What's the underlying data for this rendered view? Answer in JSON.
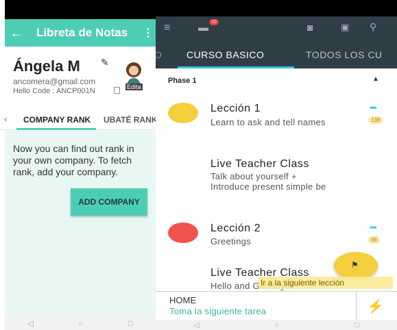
{
  "left_app": {
    "title": "Libreta de Notas",
    "back_icon": "back-arrow-icon",
    "more_icon": "more-vert-icon",
    "profile": {
      "name": "Ángela M",
      "email": "ancomera@gmail.com",
      "hello_code": "Hello Code : ANCP001N",
      "avatar_label": "Edita"
    },
    "tabs": [
      "COMPANY RANK",
      "UBATÉ RANK"
    ],
    "active_tab": "COMPANY RANK",
    "message": "Now you can find out rank in your own company. To fetch rank, add your company.",
    "add_button": "ADD COMPANY",
    "accent": "#4ecdb5"
  },
  "right_app": {
    "chat_badge": "10",
    "tabs": [
      "O",
      "CURSO BASICO",
      "TODOS LOS CU"
    ],
    "active_tab": "CURSO BASICO",
    "phase": "Phase 1",
    "lessons": [
      {
        "title": "Lección 1",
        "subtitle": "Learn to ask and tell names",
        "count": "138",
        "dot_color": "#f3cf3c",
        "dots": "•••"
      },
      {
        "title": "Live Teacher Class",
        "subtitle": "Talk about yourself + Introduce present simple be",
        "count": "",
        "dot_color": "",
        "dots": ""
      },
      {
        "title": "Lección 2",
        "subtitle": "Greetings",
        "count": "98",
        "dot_color": "#ef5350",
        "dots": "•••"
      },
      {
        "title": "Live Teacher Class",
        "subtitle": "Hello and Goodbye",
        "count": "",
        "dot_color": "",
        "dots": ""
      }
    ],
    "tooltip": "Ir a la siguiente lección",
    "bottom": {
      "home": "HOME",
      "next_task": "Toma la siguiente tarea"
    },
    "header_bg": "#2f3d47",
    "tab_accent": "#39c4e0"
  },
  "nav": {
    "back": "◁",
    "home": "○",
    "recent": "□"
  }
}
